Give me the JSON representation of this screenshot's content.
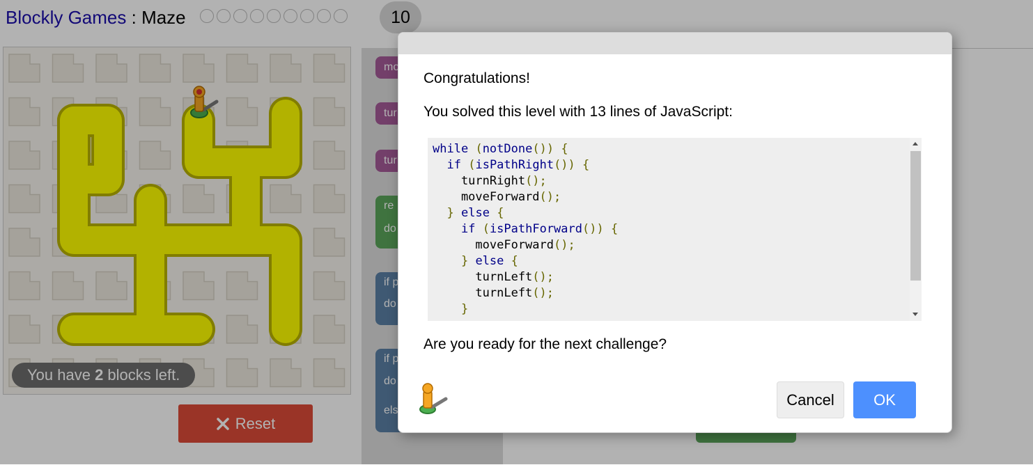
{
  "header": {
    "app_name": "Blockly Games",
    "separator": " : ",
    "game_name": "Maze",
    "level_dot_count": 9,
    "current_level": "10"
  },
  "maze": {
    "capacity_prefix": "You have ",
    "capacity_count": "2",
    "capacity_suffix": " blocks left.",
    "reset_label": "Reset",
    "reset_icon": "x-icon",
    "path_color": "#ffff00",
    "reset_color": "#dd4b39"
  },
  "toolbox": {
    "blocks": [
      {
        "label": "mo",
        "kind": "move"
      },
      {
        "label": "tur",
        "kind": "turn"
      },
      {
        "label": "tur",
        "kind": "turn"
      },
      {
        "label": "re",
        "kind": "repeat"
      },
      {
        "label": "do",
        "kind": "repeat-do"
      },
      {
        "label": "if p",
        "kind": "if"
      },
      {
        "label": "do",
        "kind": "if-do"
      },
      {
        "label": "if p",
        "kind": "ifelse"
      },
      {
        "label": "do",
        "kind": "ifelse-do"
      },
      {
        "label": "els",
        "kind": "ifelse-else"
      }
    ]
  },
  "dialog": {
    "heading": "Congratulations!",
    "lines_text": "You solved this level with 13 lines of JavaScript:",
    "code": [
      [
        {
          "t": "while",
          "c": "kw"
        },
        {
          "t": " ",
          "c": ""
        },
        {
          "t": "(",
          "c": "pn"
        },
        {
          "t": "notDone",
          "c": "kw"
        },
        {
          "t": "())",
          "c": "pn"
        },
        {
          "t": " ",
          "c": ""
        },
        {
          "t": "{",
          "c": "pn"
        }
      ],
      [
        {
          "t": "  ",
          "c": ""
        },
        {
          "t": "if",
          "c": "kw"
        },
        {
          "t": " ",
          "c": ""
        },
        {
          "t": "(",
          "c": "pn"
        },
        {
          "t": "isPathRight",
          "c": "kw"
        },
        {
          "t": "())",
          "c": "pn"
        },
        {
          "t": " ",
          "c": ""
        },
        {
          "t": "{",
          "c": "pn"
        }
      ],
      [
        {
          "t": "    turnRight",
          "c": ""
        },
        {
          "t": "();",
          "c": "pn"
        }
      ],
      [
        {
          "t": "    moveForward",
          "c": ""
        },
        {
          "t": "();",
          "c": "pn"
        }
      ],
      [
        {
          "t": "  ",
          "c": ""
        },
        {
          "t": "}",
          "c": "pn"
        },
        {
          "t": " ",
          "c": ""
        },
        {
          "t": "else",
          "c": "kw"
        },
        {
          "t": " ",
          "c": ""
        },
        {
          "t": "{",
          "c": "pn"
        }
      ],
      [
        {
          "t": "    ",
          "c": ""
        },
        {
          "t": "if",
          "c": "kw"
        },
        {
          "t": " ",
          "c": ""
        },
        {
          "t": "(",
          "c": "pn"
        },
        {
          "t": "isPathForward",
          "c": "kw"
        },
        {
          "t": "())",
          "c": "pn"
        },
        {
          "t": " ",
          "c": ""
        },
        {
          "t": "{",
          "c": "pn"
        }
      ],
      [
        {
          "t": "      moveForward",
          "c": ""
        },
        {
          "t": "();",
          "c": "pn"
        }
      ],
      [
        {
          "t": "    ",
          "c": ""
        },
        {
          "t": "}",
          "c": "pn"
        },
        {
          "t": " ",
          "c": ""
        },
        {
          "t": "else",
          "c": "kw"
        },
        {
          "t": " ",
          "c": ""
        },
        {
          "t": "{",
          "c": "pn"
        }
      ],
      [
        {
          "t": "      turnLeft",
          "c": ""
        },
        {
          "t": "();",
          "c": "pn"
        }
      ],
      [
        {
          "t": "      turnLeft",
          "c": ""
        },
        {
          "t": "();",
          "c": "pn"
        }
      ],
      [
        {
          "t": "    ",
          "c": ""
        },
        {
          "t": "}",
          "c": "pn"
        }
      ]
    ],
    "question": "Are you ready for the next challenge?",
    "cancel_label": "Cancel",
    "ok_label": "OK",
    "ok_color": "#4d90fe",
    "avatar_icon": "pegman-icon"
  }
}
